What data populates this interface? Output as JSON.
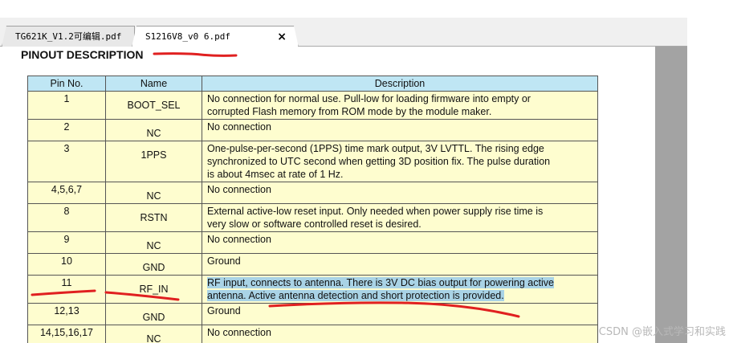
{
  "tabs": [
    {
      "label": "TG621K_V1.2可编辑.pdf",
      "active": false
    },
    {
      "label": "S1216V8_v0 6.pdf",
      "active": true,
      "close": "×"
    }
  ],
  "document": {
    "section_title": "PINOUT DESCRIPTION",
    "columns": [
      "Pin No.",
      "Name",
      "Description"
    ],
    "rows": [
      {
        "pin": "1",
        "name": "BOOT_SEL",
        "desc": [
          "No connection for normal use. Pull-low for loading firmware into empty or",
          "corrupted Flash memory from ROM mode by the module maker."
        ]
      },
      {
        "pin": "2",
        "name": "NC",
        "desc": [
          "No connection"
        ]
      },
      {
        "pin": "3",
        "name": "1PPS",
        "desc": [
          "One-pulse-per-second (1PPS) time mark output, 3V LVTTL. The rising edge",
          "synchronized to UTC second when getting 3D position fix. The pulse duration",
          "is about 4msec at rate of 1 Hz."
        ]
      },
      {
        "pin": "4,5,6,7",
        "name": "NC",
        "desc": [
          "No connection"
        ]
      },
      {
        "pin": "8",
        "name": "RSTN",
        "desc": [
          "External active-low reset input. Only needed when power supply rise time is",
          "very slow or software controlled reset is desired."
        ]
      },
      {
        "pin": "9",
        "name": "NC",
        "desc": [
          "No connection"
        ]
      },
      {
        "pin": "10",
        "name": "GND",
        "desc": [
          "Ground"
        ]
      },
      {
        "pin": "11",
        "name": "RF_IN",
        "desc": [
          "RF input, connects to antenna. There is 3V DC bias output for powering active",
          "antenna. Active antenna detection and short protection is provided."
        ]
      },
      {
        "pin": "12,13",
        "name": "GND",
        "desc": [
          "Ground"
        ]
      },
      {
        "pin": "14,15,16,17",
        "name": "NC",
        "desc": [
          "No connection"
        ]
      }
    ]
  },
  "watermark": "CSDN @嵌入式学习和实践",
  "colors": {
    "header_bg": "#bfe6f4",
    "cell_bg": "#fefdcf",
    "highlight": "#a9d3e6",
    "annotation_red": "#e02020",
    "scroll_gutter": "#a3a3a3"
  }
}
